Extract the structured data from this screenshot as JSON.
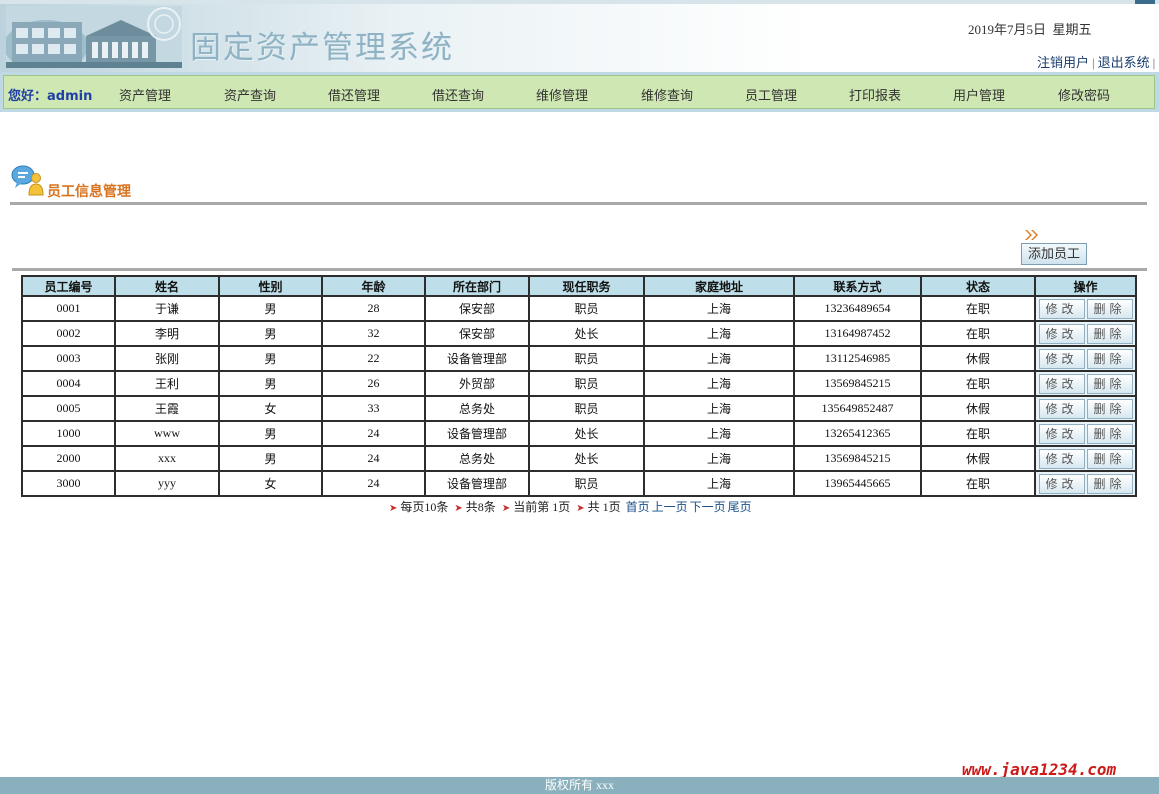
{
  "header": {
    "title": "固定资产管理系统",
    "date": "2019年7月5日  星期五",
    "logout_user": "注销用户",
    "separator": "|",
    "exit_system": "退出系统",
    "trailing_sep": "|"
  },
  "nav": {
    "greeting": "您好：admin",
    "items": [
      "资产管理",
      "资产查询",
      "借还管理",
      "借还查询",
      "维修管理",
      "维修查询",
      "员工管理",
      "打印报表",
      "用户管理",
      "修改密码"
    ]
  },
  "section": {
    "title": "员工信息管理",
    "add_button": "添加员工"
  },
  "table": {
    "headers": [
      "员工编号",
      "姓名",
      "性别",
      "年龄",
      "所在部门",
      "现任职务",
      "家庭地址",
      "联系方式",
      "状态",
      "操作"
    ],
    "edit_label": "修改",
    "delete_label": "删除",
    "rows": [
      [
        "0001",
        "于谦",
        "男",
        "28",
        "保安部",
        "职员",
        "上海",
        "13236489654",
        "在职"
      ],
      [
        "0002",
        "李明",
        "男",
        "32",
        "保安部",
        "处长",
        "上海",
        "13164987452",
        "在职"
      ],
      [
        "0003",
        "张刚",
        "男",
        "22",
        "设备管理部",
        "职员",
        "上海",
        "13112546985",
        "休假"
      ],
      [
        "0004",
        "王利",
        "男",
        "26",
        "外贸部",
        "职员",
        "上海",
        "13569845215",
        "在职"
      ],
      [
        "0005",
        "王霞",
        "女",
        "33",
        "总务处",
        "职员",
        "上海",
        "135649852487",
        "休假"
      ],
      [
        "1000",
        "www",
        "男",
        "24",
        "设备管理部",
        "处长",
        "上海",
        "13265412365",
        "在职"
      ],
      [
        "2000",
        "xxx",
        "男",
        "24",
        "总务处",
        "处长",
        "上海",
        "13569845215",
        "休假"
      ],
      [
        "3000",
        "yyy",
        "女",
        "24",
        "设备管理部",
        "职员",
        "上海",
        "13965445665",
        "在职"
      ]
    ]
  },
  "pagination": {
    "per_page": "每页10条",
    "total": "共8条",
    "current": "当前第 1页",
    "pages": "共 1页",
    "first": "首页",
    "prev": "上一页",
    "next": "下一页",
    "last": "尾页"
  },
  "footer": {
    "copyright": "版权所有 xxx",
    "watermark": "www.java1234.com"
  },
  "colors": {
    "nav_bg": "#cee7b3",
    "table_header_bg": "#bedfe9",
    "section_title": "#d8731e",
    "footer_bg": "#8ab0bd",
    "watermark": "#cc1a1a"
  }
}
